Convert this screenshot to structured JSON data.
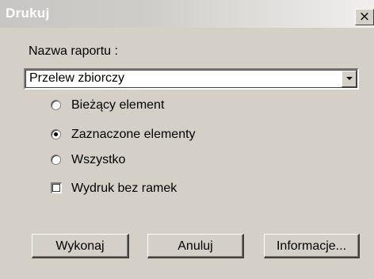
{
  "window": {
    "title": "Drukuj",
    "close_label": "×"
  },
  "report": {
    "label": "Nazwa raportu :",
    "selected_value": "Przelew zbiorczy"
  },
  "scope": {
    "options": [
      {
        "label": "Bieżący element",
        "checked": false
      },
      {
        "label": "Zaznaczone elementy",
        "checked": true
      },
      {
        "label": "Wszystko",
        "checked": false
      }
    ]
  },
  "options": {
    "no_frames_label": "Wydruk bez ramek",
    "no_frames_checked": false
  },
  "buttons": {
    "execute_label": "Wykonaj",
    "cancel_label": "Anuluj",
    "info_label": "Informacje..."
  }
}
